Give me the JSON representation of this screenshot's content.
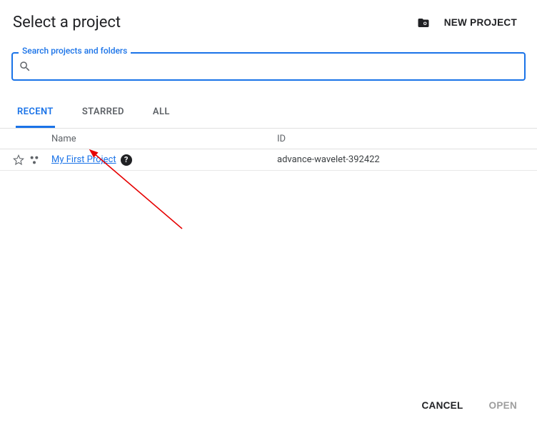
{
  "header": {
    "title": "Select a project",
    "new_project_label": "NEW PROJECT"
  },
  "search": {
    "label": "Search projects and folders",
    "value": ""
  },
  "tabs": {
    "recent": "RECENT",
    "starred": "STARRED",
    "all": "ALL",
    "active": "recent"
  },
  "columns": {
    "name": "Name",
    "id": "ID"
  },
  "rows": [
    {
      "name": "My First Project",
      "id": "advance-wavelet-392422",
      "starred": false
    }
  ],
  "footer": {
    "cancel": "CANCEL",
    "open": "OPEN"
  },
  "help_char": "?"
}
